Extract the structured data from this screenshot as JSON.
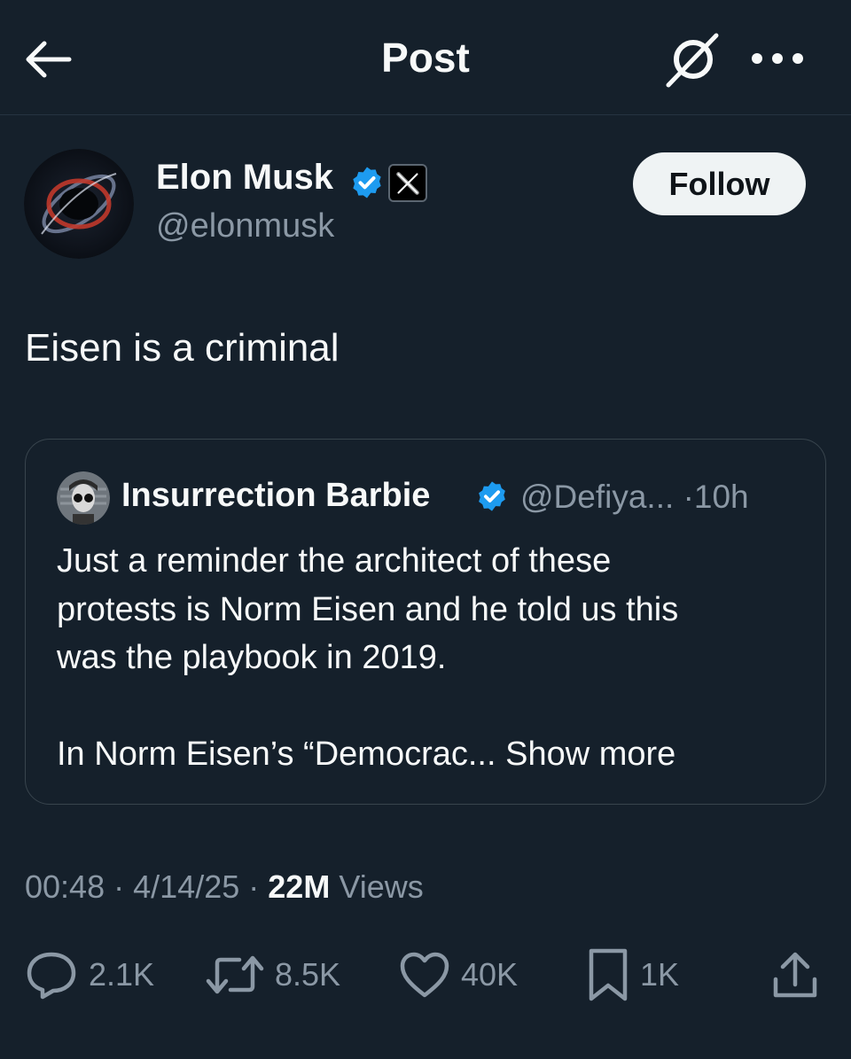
{
  "header": {
    "title": "Post",
    "back_icon": "arrow-left-icon",
    "grok_icon": "grok-icon",
    "more_icon": "more-horizontal-icon"
  },
  "author": {
    "name": "Elon Musk",
    "handle": "@elonmusk",
    "verified_color": "#1d9bf0",
    "affiliate_badge": "x-logo-icon",
    "follow_label": "Follow"
  },
  "post": {
    "text": "Eisen is a criminal"
  },
  "quote": {
    "name": "Insurrection Barbie",
    "handle": "@Defiya...",
    "separator": "·",
    "time": "10h",
    "body_line1": "Just a reminder the architect of these",
    "body_line2": "protests is Norm Eisen and he told us this",
    "body_line3": "was the playbook in 2019.",
    "body_line4": "In Norm Eisen’s “Democrac...",
    "show_more": "Show more"
  },
  "meta": {
    "time": "00:48",
    "sep1": "·",
    "date": "4/14/25",
    "sep2": "·",
    "views_count": "22M",
    "views_label": "Views"
  },
  "actions": {
    "replies": "2.1K",
    "reposts": "8.5K",
    "likes": "40K",
    "bookmarks": "1K"
  },
  "colors": {
    "background": "#15202b",
    "text": "#e7e9ea",
    "secondary": "#8b98a5",
    "border": "#38444d",
    "accent": "#1d9bf0"
  }
}
